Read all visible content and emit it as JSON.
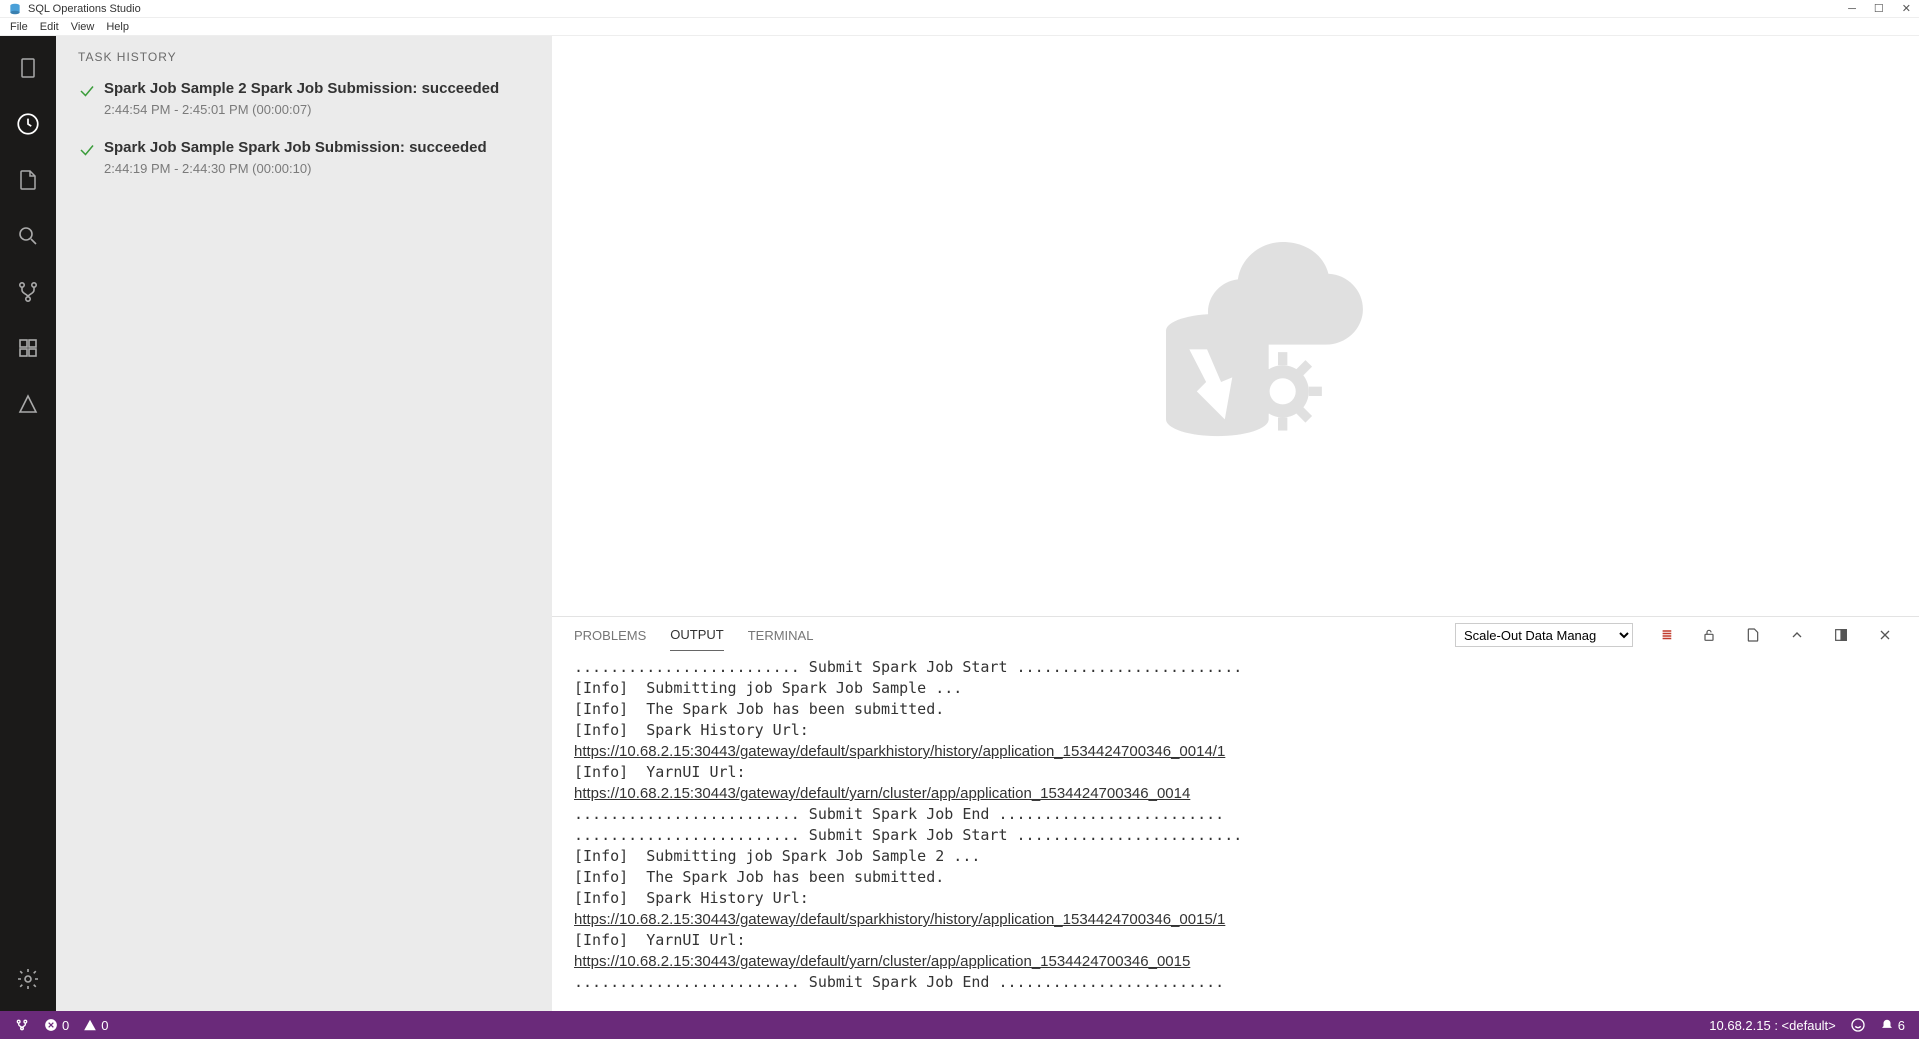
{
  "title": "SQL Operations Studio",
  "menu": {
    "file": "File",
    "edit": "Edit",
    "view": "View",
    "help": "Help"
  },
  "sidebar": {
    "title": "TASK HISTORY",
    "tasks": [
      {
        "title": "Spark Job Sample 2 Spark Job Submission: succeeded",
        "time": "2:44:54 PM - 2:45:01 PM (00:00:07)"
      },
      {
        "title": "Spark Job Sample Spark Job Submission: succeeded",
        "time": "2:44:19 PM - 2:44:30 PM (00:00:10)"
      }
    ]
  },
  "panel": {
    "tabs": {
      "problems": "PROBLEMS",
      "output": "OUTPUT",
      "terminal": "TERMINAL"
    },
    "dropdown_selected": "Scale-Out Data Manag",
    "output_lines": [
      "......................... Submit Spark Job Start .........................",
      "[Info]  Submitting job Spark Job Sample ...",
      "[Info]  The Spark Job has been submitted.",
      "[Info]  Spark History Url:",
      {
        "link": "https://10.68.2.15:30443/gateway/default/sparkhistory/history/application_1534424700346_0014/1"
      },
      "[Info]  YarnUI Url:",
      {
        "link": "https://10.68.2.15:30443/gateway/default/yarn/cluster/app/application_1534424700346_0014"
      },
      "......................... Submit Spark Job End .........................",
      "......................... Submit Spark Job Start .........................",
      "[Info]  Submitting job Spark Job Sample 2 ...",
      "[Info]  The Spark Job has been submitted.",
      "[Info]  Spark History Url:",
      {
        "link": "https://10.68.2.15:30443/gateway/default/sparkhistory/history/application_1534424700346_0015/1"
      },
      "[Info]  YarnUI Url:",
      {
        "link": "https://10.68.2.15:30443/gateway/default/yarn/cluster/app/application_1534424700346_0015"
      },
      "......................... Submit Spark Job End ........................."
    ]
  },
  "statusbar": {
    "errors": "0",
    "warnings": "0",
    "connection": "10.68.2.15 : <default>",
    "notifications": "6"
  }
}
